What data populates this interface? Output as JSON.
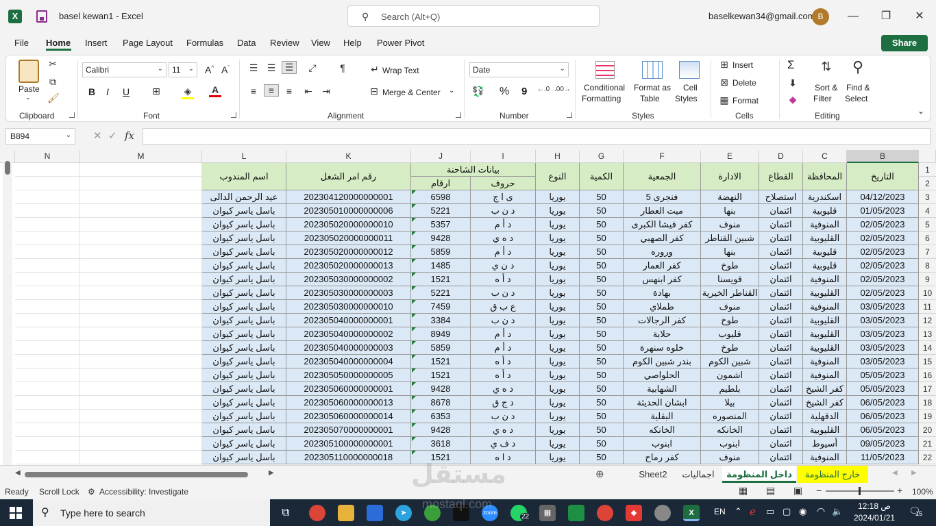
{
  "window": {
    "title": "basel kewan1  -  Excel",
    "search_placeholder": "Search (Alt+Q)",
    "account": "baselkewan34@gmail.com",
    "avatar_initial": "B"
  },
  "menu": {
    "tabs": [
      "File",
      "Home",
      "Insert",
      "Page Layout",
      "Formulas",
      "Data",
      "Review",
      "View",
      "Help",
      "Power Pivot"
    ],
    "share": "Share"
  },
  "ribbon": {
    "clipboard": {
      "paste": "Paste",
      "label": "Clipboard"
    },
    "font": {
      "name": "Calibri",
      "size": "11",
      "label": "Font",
      "grow": "A^",
      "shrink": "Aˇ",
      "bold": "B",
      "italic": "I",
      "underline": "U"
    },
    "alignment": {
      "wrap": "Wrap Text",
      "merge": "Merge & Center",
      "label": "Alignment"
    },
    "number": {
      "format": "Date",
      "label": "Number",
      "percent": "%",
      "comma": "9"
    },
    "styles": {
      "conditional": "Conditional",
      "conditional2": "Formatting",
      "format_table": "Format as",
      "format_table2": "Table",
      "cell_styles": "Cell",
      "cell_styles2": "Styles",
      "label": "Styles"
    },
    "cells": {
      "insert": "Insert",
      "delete": "Delete",
      "format": "Format",
      "label": "Cells"
    },
    "editing": {
      "sort": "Sort &",
      "sort2": "Filter",
      "find": "Find &",
      "find2": "Select",
      "label": "Editing",
      "sigma": "Σ"
    }
  },
  "formula_bar": {
    "name_box": "B894",
    "fx": "fx"
  },
  "columns": [
    "N",
    "M",
    "L",
    "K",
    "J",
    "I",
    "H",
    "G",
    "F",
    "E",
    "D",
    "C",
    "B"
  ],
  "header_row": {
    "L": "اسم المندوب",
    "K": "رقم امر الشغل",
    "JI": "بيانات الشاحنة",
    "J": "ارقام",
    "I": "حروف",
    "H": "النوع",
    "G": "الكمية",
    "F": "الجمعية",
    "E": "الادارة",
    "D": "القطاع",
    "C": "المحافظة",
    "B": "التاريخ"
  },
  "row_numbers": [
    "1",
    "2",
    "3",
    "4",
    "5",
    "6",
    "7",
    "8",
    "9",
    "10",
    "11",
    "12",
    "13",
    "14",
    "15",
    "16",
    "17",
    "18",
    "19",
    "20",
    "21",
    "22"
  ],
  "rows": [
    [
      "عيد الرحمن الدالى",
      "202304120000000001",
      "6598",
      "ى ا ج",
      "يوريا",
      "50",
      "فنجرى 5",
      "النهضة",
      "استصلاح",
      "اسكندرية",
      "04/12/2023"
    ],
    [
      "باسل ياسر كيوان",
      "202305010000000006",
      "5221",
      "د ن ب",
      "يوريا",
      "50",
      "ميت العطار",
      "بنها",
      "ائتمان",
      "قليوبية",
      "01/05/2023"
    ],
    [
      "باسل ياسر كيوان",
      "202305020000000010",
      "5357",
      "د أ م",
      "يوريا",
      "50",
      "كفر فيشا الكبرى",
      "منوف",
      "ائتمان",
      "المنوفية",
      "02/05/2023"
    ],
    [
      "باسل ياسر كيوان",
      "202305020000000011",
      "9428",
      "د ه ي",
      "يوريا",
      "50",
      "كفر الصهبي",
      "شبين القناطر",
      "ائتمان",
      "القليوبية",
      "02/05/2023"
    ],
    [
      "باسل ياسر كيوان",
      "202305020000000012",
      "5859",
      "د أ م",
      "يوريا",
      "50",
      "وروره",
      "بنها",
      "ائتمان",
      "قليوبية",
      "02/05/2023"
    ],
    [
      "باسل ياسر كيوان",
      "202305020000000013",
      "1485",
      "د ن ي",
      "يوريا",
      "50",
      "كفر العمار",
      "طوخ",
      "ائتمان",
      "قليوبية",
      "02/05/2023"
    ],
    [
      "باسل ياسر كيوان",
      "202305030000000002",
      "1521",
      "د أ ه",
      "يوريا",
      "50",
      "كفر ابنهس",
      "قويسنا",
      "ائتمان",
      "المنوفية",
      "02/05/2023"
    ],
    [
      "باسل ياسر كيوان",
      "202305030000000003",
      "5221",
      "د ن ب",
      "يوريا",
      "50",
      "بهادة",
      "القناطر الخيرية",
      "ائتمان",
      "القليوبية",
      "02/05/2023"
    ],
    [
      "باسل ياسر كيوان",
      "202305030000000010",
      "7459",
      "ع ب ق",
      "يوريا",
      "50",
      "طملاي",
      "منوف",
      "ائتمان",
      "المنوفية",
      "03/05/2023"
    ],
    [
      "باسل ياسر كيوان",
      "202305040000000001",
      "3384",
      "د ن ب",
      "يوريا",
      "50",
      "كفر الرجالات",
      "طوخ",
      "ائتمان",
      "القليوبية",
      "03/05/2023"
    ],
    [
      "باسل ياسر كيوان",
      "202305040000000002",
      "8949",
      "د أ م",
      "يوريا",
      "50",
      "حلابة",
      "قليوب",
      "ائتمان",
      "القليوبية",
      "03/05/2023"
    ],
    [
      "باسل ياسر كيوان",
      "202305040000000003",
      "5859",
      "د أ م",
      "يوريا",
      "50",
      "خلوه سنهرة",
      "طوخ",
      "ائتمان",
      "القليوبية",
      "03/05/2023"
    ],
    [
      "باسل ياسر كيوان",
      "202305040000000004",
      "1521",
      "د أ ه",
      "يوريا",
      "50",
      "بندر شبين الكوم",
      "شبين الكوم",
      "ائتمان",
      "المنوفية",
      "03/05/2023"
    ],
    [
      "باسل ياسر كيوان",
      "202305050000000005",
      "1521",
      "د أ ه",
      "يوريا",
      "50",
      "الحلواصي",
      "اشمون",
      "ائتمان",
      "المنوفية",
      "05/05/2023"
    ],
    [
      "باسل ياسر كيوان",
      "202305060000000001",
      "9428",
      "د ه ي",
      "يوريا",
      "50",
      "الشهابية",
      "بلطيم",
      "ائتمان",
      "كفر الشيخ",
      "05/05/2023"
    ],
    [
      "باسل ياسر كيوان",
      "202305060000000013",
      "8678",
      "د ج ق",
      "يوريا",
      "50",
      "ابشان الحديثة",
      "بيلا",
      "ائتمان",
      "كفر الشيخ",
      "06/05/2023"
    ],
    [
      "باسل ياسر كيوان",
      "202305060000000014",
      "6353",
      "د ن ب",
      "يوريا",
      "50",
      "البقلية",
      "المنصوره",
      "ائتمان",
      "الدقهلية",
      "06/05/2023"
    ],
    [
      "باسل ياسر كيوان",
      "202305070000000001",
      "9428",
      "د ه ي",
      "يوريا",
      "50",
      "الخانكه",
      "الخانكه",
      "ائتمان",
      "القليوبية",
      "06/05/2023"
    ],
    [
      "باسل ياسر كيوان",
      "202305100000000001",
      "3618",
      "د ف ي",
      "يوريا",
      "50",
      "ابنوب",
      "ابنوب",
      "ائتمان",
      "أسيوط",
      "09/05/2023"
    ],
    [
      "باسل ياسر كيوان",
      "202305110000000018",
      "1521",
      "د ا ه",
      "يوريا",
      "50",
      "كفر رماح",
      "منوف",
      "ائتمان",
      "المنوفية",
      "11/05/2023"
    ]
  ],
  "sheet_tabs": [
    "Sheet2",
    "اجماليات",
    "داخل المنظومة",
    "خارج المنظومة"
  ],
  "status": {
    "ready": "Ready",
    "scroll_lock": "Scroll Lock",
    "accessibility": "Accessibility: Investigate",
    "zoom": "100%"
  },
  "taskbar": {
    "search_placeholder": "Type here to search",
    "lang": "EN",
    "time": "12:18 ص",
    "date": "2024/01/21",
    "badge_whatsapp": "22",
    "notif_count": "15"
  },
  "watermark": {
    "main": "مستقل",
    "sub": "mostaql.com"
  },
  "colors": {
    "excel_green": "#1d6f42",
    "header_fill": "#d6ecc4",
    "data_fill": "#dbe8f5",
    "yellow_tab": "#ffff00"
  }
}
